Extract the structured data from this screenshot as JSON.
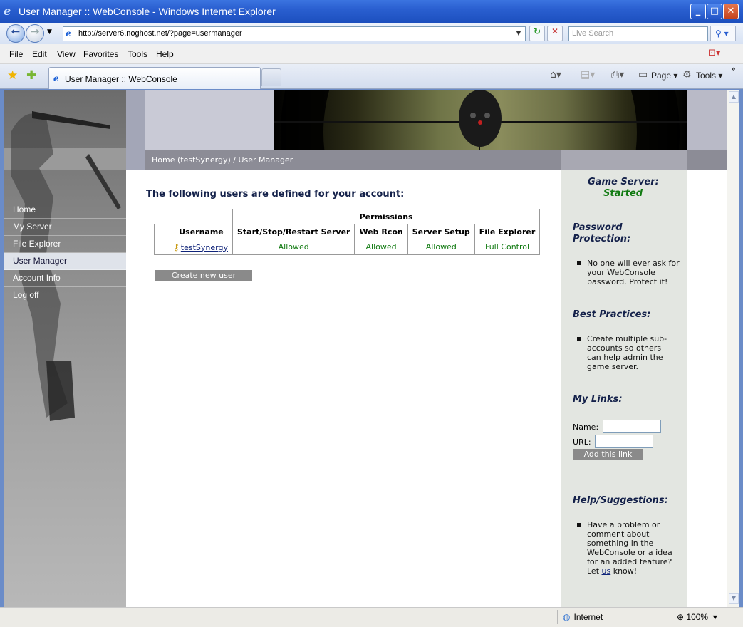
{
  "window": {
    "title": "User Manager :: WebConsole - Windows Internet Explorer",
    "minimize": "_",
    "maximize": "□",
    "close": "✕"
  },
  "navigation": {
    "url": "http://server6.noghost.net/?page=usermanager",
    "search_placeholder": "Live Search"
  },
  "menu": {
    "items": [
      "File",
      "Edit",
      "View",
      "Favorites",
      "Tools",
      "Help"
    ]
  },
  "tabs": {
    "active_label": "User Manager :: WebConsole",
    "page_label": "Page",
    "tools_label": "Tools"
  },
  "sidebar": {
    "items": [
      {
        "label": "Home"
      },
      {
        "label": "My Server"
      },
      {
        "label": "File Explorer"
      },
      {
        "label": "User Manager"
      },
      {
        "label": "Account Info"
      },
      {
        "label": "Log off"
      }
    ],
    "active_index": 3
  },
  "breadcrumb": "Home (testSynergy) / User Manager",
  "main": {
    "heading": "The following users are defined for your account:",
    "permissions_header": "Permissions",
    "columns": [
      "Username",
      "Start/Stop/Restart Server",
      "Web Rcon",
      "Server Setup",
      "File Explorer"
    ],
    "rows": [
      {
        "username": "testSynergy",
        "start_stop": "Allowed",
        "web_rcon": "Allowed",
        "server_setup": "Allowed",
        "file_explorer": "Full Control"
      }
    ],
    "create_button": "Create new user"
  },
  "right_panel": {
    "game_server_title": "Game Server:",
    "game_server_status": "Started",
    "password_title": "Password Protection:",
    "password_text": "No one will ever ask for your WebConsole password. Protect it!",
    "best_title": "Best Practices:",
    "best_text": "Create multiple sub-accounts so others can help admin the game server.",
    "links_title": "My Links:",
    "name_label": "Name:",
    "url_label": "URL:",
    "add_button": "Add this link",
    "help_title": "Help/Suggestions:",
    "help_text_before": "Have a problem or comment about something in the WebConsole or a idea for an added feature? Let",
    "help_link": "us",
    "help_text_after": "know!"
  },
  "status": {
    "zone": "Internet",
    "zoom": "100%"
  },
  "colors": {
    "title_blue": "#2a5fd0",
    "allowed_green": "#117a11",
    "heading_navy": "#14214a",
    "button_gray": "#8a8a8a"
  }
}
